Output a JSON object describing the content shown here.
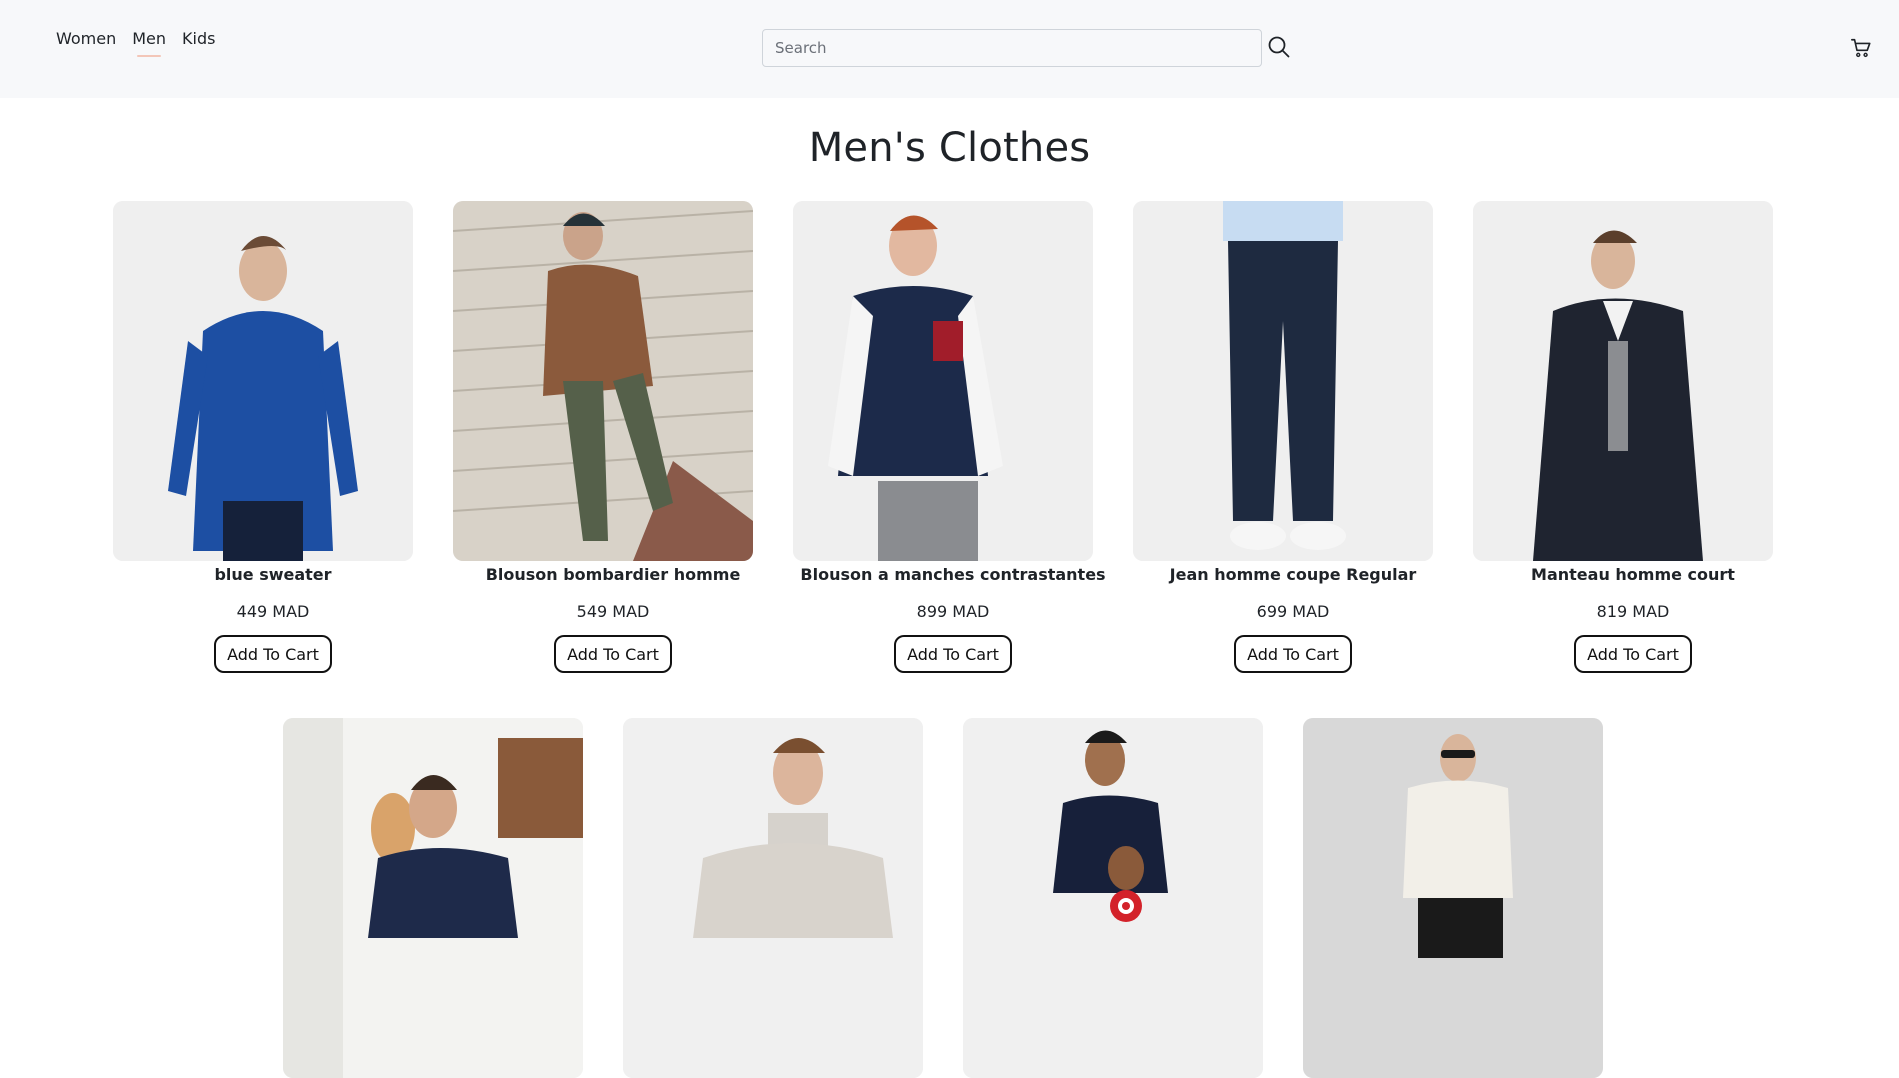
{
  "nav": {
    "items": [
      {
        "label": "Women",
        "active": false
      },
      {
        "label": "Men",
        "active": true
      },
      {
        "label": "Kids",
        "active": false
      }
    ]
  },
  "search": {
    "placeholder": "Search",
    "value": "",
    "icon": "search-icon"
  },
  "cart": {
    "icon": "cart-icon"
  },
  "page": {
    "title": "Men's Clothes"
  },
  "colors": {
    "accent_underline": "#f3c6b8",
    "header_bg": "#f7f8fa"
  },
  "products": [
    {
      "name": "blue sweater",
      "price": "449 MAD",
      "button": "Add To Cart"
    },
    {
      "name": "Blouson bombardier homme",
      "price": "549 MAD",
      "button": "Add To Cart"
    },
    {
      "name": "Blouson a manches contrastantes",
      "price": "899 MAD",
      "button": "Add To Cart"
    },
    {
      "name": "Jean homme coupe Regular",
      "price": "699 MAD",
      "button": "Add To Cart"
    },
    {
      "name": "Manteau homme court",
      "price": "819 MAD",
      "button": "Add To Cart"
    },
    {
      "name": "",
      "price": "",
      "button": ""
    },
    {
      "name": "",
      "price": "",
      "button": ""
    },
    {
      "name": "",
      "price": "",
      "button": ""
    },
    {
      "name": "",
      "price": "",
      "button": ""
    }
  ]
}
